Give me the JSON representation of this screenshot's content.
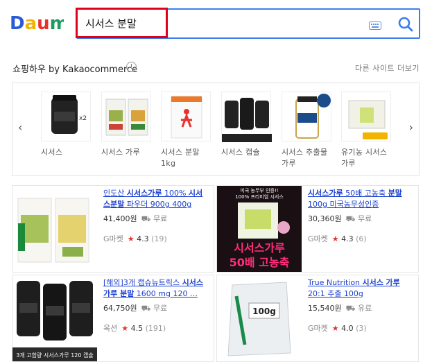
{
  "brand": "Daum",
  "colors": {
    "accent": "#3b7ded",
    "highlight": "#e0001a",
    "link": "#1b3fcf",
    "star": "#e8332b"
  },
  "search": {
    "value": "시서스 분말",
    "keyboard_icon": "keyboard-icon",
    "search_icon": "search-icon"
  },
  "shopping": {
    "title": "쇼핑하우 by Kakaocommerce",
    "info_mark": "!",
    "more": "다른 사이트 더보기"
  },
  "carousel": {
    "prev": "‹",
    "next": "›",
    "items": [
      {
        "label": "시서스"
      },
      {
        "label": "시서스 가루"
      },
      {
        "label": "시서스 분말 1kg"
      },
      {
        "label": "시서스 캡슐"
      },
      {
        "label": "시서스 추출물 가루"
      },
      {
        "label": "유기농 시서스 가루"
      }
    ]
  },
  "products": [
    {
      "title_pre": "인도산 ",
      "title_bold": "시서스가루",
      "title_mid": " 100% ",
      "title_bold2": "시서스분말",
      "title_post": " 파우더 900g 400g",
      "price": "41,400원",
      "shipping": "무료",
      "seller": "G마켓",
      "rating": "4.3",
      "reviews": "(19)"
    },
    {
      "title_pre": "",
      "title_bold": "시서스가루",
      "title_mid": " 50배 고농축 ",
      "title_bold2": "분말",
      "title_post": " 100g 미국농무성인증",
      "price": "30,360원",
      "shipping": "무료",
      "seller": "G마켓",
      "rating": "4.3",
      "reviews": "(6)",
      "banner_top": "미국 농무부 인증!!",
      "banner_mid": "100% 프리미엄 시서스",
      "banner_big1": "시서스가루",
      "banner_big2": "50배 고농축"
    },
    {
      "title_pre": "[해외]3개 캡슈뉴트릭스 ",
      "title_bold": "시서스",
      "title_mid": " ",
      "title_bold2": "가루 분말",
      "title_post": " 1600 mg 120 …",
      "price": "64,750원",
      "shipping": "무료",
      "seller": "옥션",
      "rating": "4.5",
      "reviews": "(191)",
      "caption": "3개 고함량 시서스가루 120 캡슐"
    },
    {
      "title_pre": "True Nutrition ",
      "title_bold": "시서스",
      "title_mid": " ",
      "title_bold2": "가루",
      "title_post": " 20:1 추출 100g",
      "price": "15,540원",
      "shipping": "유료",
      "seller": "G마켓",
      "rating": "4.0",
      "reviews": "(3)",
      "bag_label": "100g"
    }
  ]
}
